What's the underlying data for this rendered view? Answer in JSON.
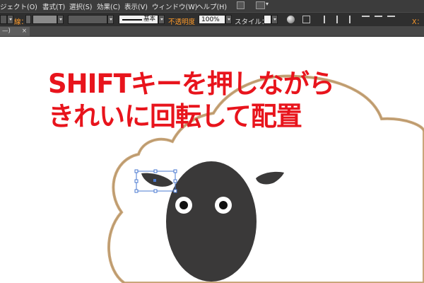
{
  "menubar": {
    "items": [
      "ジェクト(O)",
      "書式(T)",
      "選択(S)",
      "効果(C)",
      "表示(V)",
      "ウィンドウ(W)",
      "ヘルプ(H)"
    ]
  },
  "optionsbar": {
    "stroke_label": "線：",
    "stroke_preset": "基本",
    "opacity_label": "不透明度",
    "opacity_value": "100%",
    "style_label": "スタイル：",
    "x_label": "X："
  },
  "document_tab": {
    "label": "—)",
    "close": "×"
  },
  "artboard": {
    "heading_line1": "SHIFTキーを押しながら",
    "heading_line2": "きれいに回転して配置"
  },
  "colors": {
    "heading": "#e8141c",
    "cloud_outline": "#c9a67a",
    "sheep_face": "#3a3939",
    "selection": "#4a78d0"
  },
  "icons": [
    "tool-icon",
    "grid-icon",
    "chevron-down-icon",
    "globe-icon",
    "align-icon",
    "close-icon"
  ]
}
